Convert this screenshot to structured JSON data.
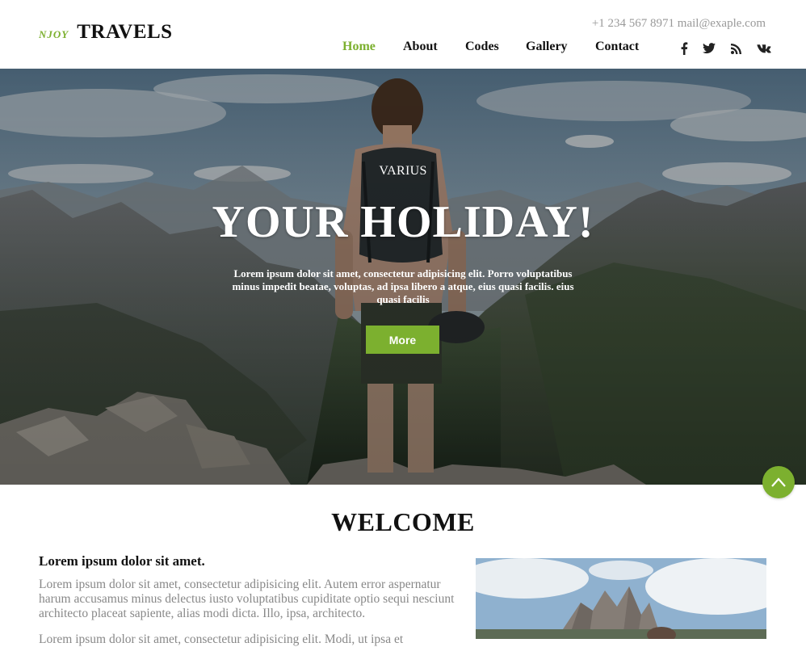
{
  "header": {
    "logo_small": "NJOY",
    "logo_big": "TRAVELS",
    "contact": "+1 234 567 8971 mail@exaple.com",
    "nav": [
      "Home",
      "About",
      "Codes",
      "Gallery",
      "Contact"
    ],
    "active_nav": "Home",
    "social_icons": [
      "facebook-icon",
      "twitter-icon",
      "rss-icon",
      "vk-icon"
    ]
  },
  "hero": {
    "kicker": "VARIUS",
    "title": "YOUR HOLIDAY!",
    "text": "Lorem ipsum dolor sit amet, consectetur adipisicing elit. Porro voluptatibus minus impedit beatae, voluptas, ad ipsa libero a atque, eius quasi facilis. eius quasi facilis",
    "button": "More"
  },
  "welcome": {
    "title": "WELCOME",
    "subtitle": "Lorem ipsum dolor sit amet.",
    "paragraph1": "Lorem ipsum dolor sit amet, consectetur adipisicing elit. Autem error aspernatur harum accusamus minus delectus iusto voluptatibus cupiditate optio sequi nesciunt architecto placeat sapiente, alias modi dicta. Illo, ipsa, architecto.",
    "paragraph2": "Lorem ipsum dolor sit amet, consectetur adipisicing elit. Modi, ut ipsa et"
  },
  "colors": {
    "accent": "#7cb02f",
    "text_dark": "#111111",
    "text_muted": "#888888"
  },
  "scroll_top_icon": "chevron-up-icon"
}
